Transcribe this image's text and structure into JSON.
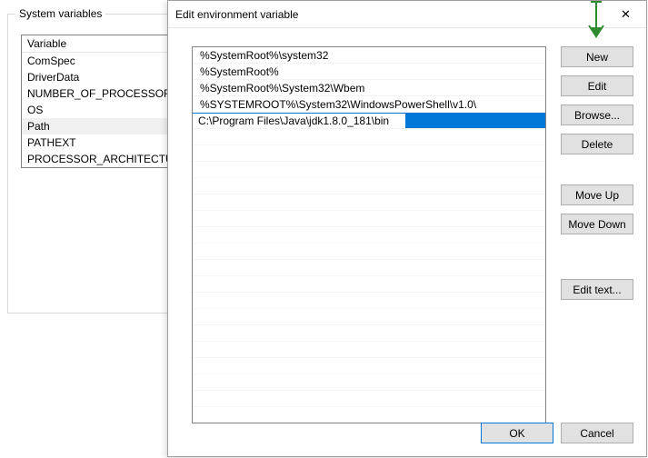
{
  "background": {
    "group_label": "System variables",
    "column_header": "Variable",
    "rows": [
      "ComSpec",
      "DriverData",
      "NUMBER_OF_PROCESSORS",
      "OS",
      "Path",
      "PATHEXT",
      "PROCESSOR_ARCHITECTURE"
    ],
    "selected_index": 4
  },
  "dialog": {
    "title": "Edit environment variable",
    "close_glyph": "✕",
    "entries": [
      "%SystemRoot%\\system32",
      "%SystemRoot%",
      "%SystemRoot%\\System32\\Wbem",
      "%SYSTEMROOT%\\System32\\WindowsPowerShell\\v1.0\\"
    ],
    "editing_value": "C:\\Program Files\\Java\\jdk1.8.0_181\\bin",
    "buttons": {
      "new": "New",
      "edit": "Edit",
      "browse": "Browse...",
      "delete": "Delete",
      "move_up": "Move Up",
      "move_down": "Move Down",
      "edit_text": "Edit text...",
      "ok": "OK",
      "cancel": "Cancel"
    }
  },
  "annotation": {
    "arrow_color": "#2e8b2e"
  }
}
